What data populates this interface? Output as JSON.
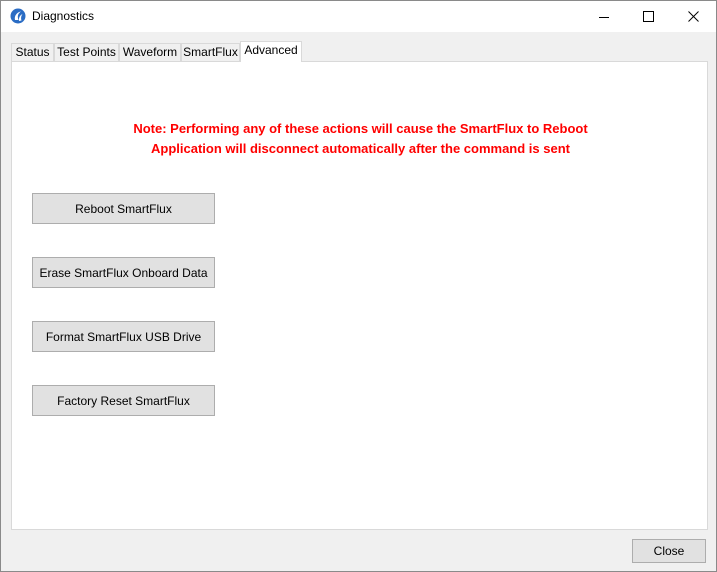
{
  "window": {
    "title": "Diagnostics",
    "icon": "app-swirl-icon"
  },
  "titlebar_controls": {
    "minimize_icon": "minimize-icon",
    "maximize_icon": "maximize-icon",
    "close_icon": "close-icon"
  },
  "tabs": [
    {
      "label": "Status",
      "active": false
    },
    {
      "label": "Test Points",
      "active": false
    },
    {
      "label": "Waveform",
      "active": false
    },
    {
      "label": "SmartFlux",
      "active": false
    },
    {
      "label": "Advanced",
      "active": true
    }
  ],
  "advanced": {
    "note_line1": "Note:  Performing any of these actions will cause the SmartFlux to Reboot",
    "note_line2": "Application will disconnect automatically after the command is sent",
    "note_color": "#ff0000",
    "buttons": {
      "reboot": "Reboot SmartFlux",
      "erase": "Erase SmartFlux Onboard Data",
      "format": "Format SmartFlux USB Drive",
      "factory_reset": "Factory Reset SmartFlux"
    }
  },
  "footer": {
    "close_label": "Close"
  }
}
